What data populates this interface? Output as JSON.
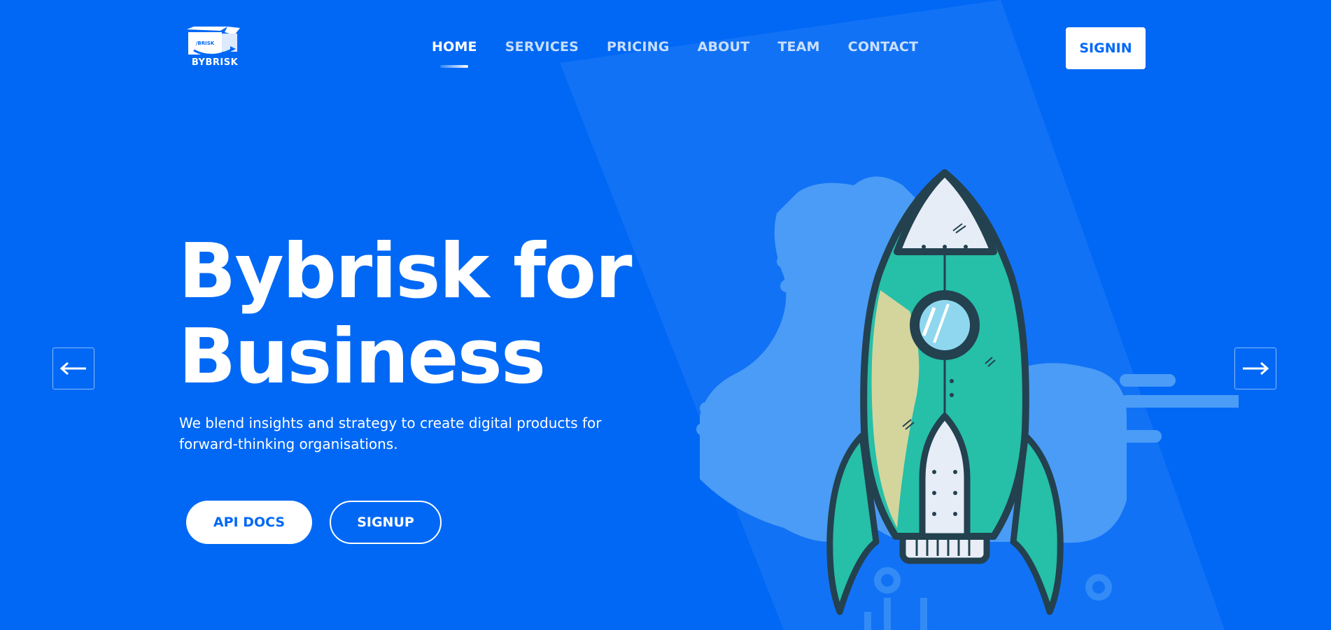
{
  "brand": {
    "logo_box_text": "/BRISK",
    "name": "BYBRISK"
  },
  "nav": {
    "items": [
      {
        "label": "HOME",
        "active": true
      },
      {
        "label": "SERVICES",
        "active": false
      },
      {
        "label": "PRICING",
        "active": false
      },
      {
        "label": "ABOUT",
        "active": false
      },
      {
        "label": "TEAM",
        "active": false
      },
      {
        "label": "CONTACT",
        "active": false
      }
    ],
    "signin_label": "SIGNIN"
  },
  "hero": {
    "title_line1": "Bybrisk for",
    "title_line2": "Business",
    "subtitle": "We blend insights and strategy to create digital products for forward-thinking organisations.",
    "api_docs_label": "API DOCS",
    "signup_label": "SIGNUP"
  },
  "slider": {
    "prev_icon": "arrow-left-icon",
    "next_icon": "arrow-right-icon"
  },
  "illustration": {
    "subject": "rocket-icon"
  },
  "colors": {
    "background": "#0068f5",
    "cloud": "#4a9cf6",
    "rocket_body": "#26bfa8",
    "rocket_outline": "#23414f",
    "button_text": "#0068f5"
  }
}
